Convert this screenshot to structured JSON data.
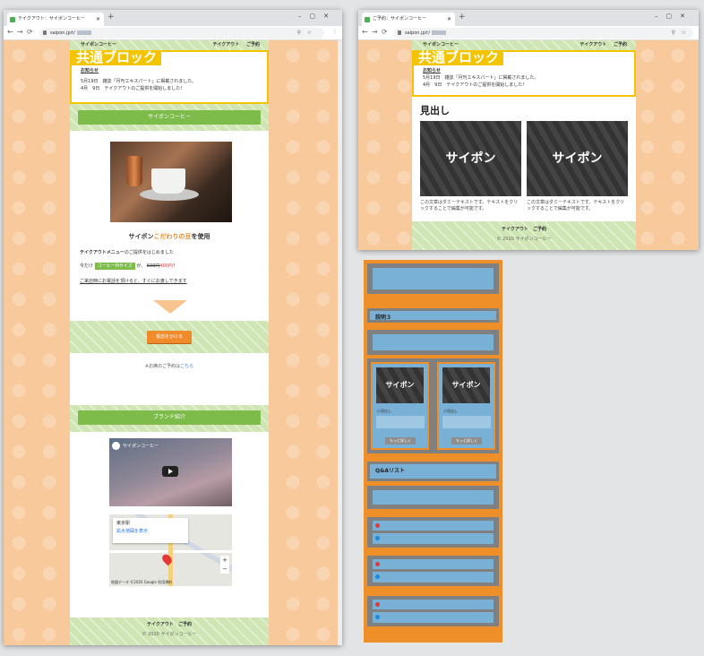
{
  "left_window": {
    "tab_title": "テイクアウト：サイポンコーヒー",
    "url": "saipon.jp/t/",
    "header": {
      "brand": "サイポンコーヒー",
      "nav": [
        "テイクアウト",
        "ご予約"
      ]
    },
    "common_block_label": "共通ブロック",
    "news": {
      "title": "お知らせ",
      "items": [
        "5月19日　雑誌「月刊エキスパート」に掲載されました。",
        "4月　9日　テイクアウトのご提供を開始しました！"
      ]
    },
    "section_bar": "サイポンコーヒー",
    "headline_prefix": "サイポン",
    "headline_emph": "こだわりの豆",
    "headline_suffix": "を使用",
    "intro_bold": "テイクアウトメニュー",
    "intro_rest": "のご提供をはじめました",
    "price_pre": "今だけ",
    "price_badge": "コーヒーMサイズ",
    "price_mid": "が、",
    "price_old": "500円",
    "price_new": "400円",
    "price_end": "！",
    "phone_note": "ご来店時にお電話を頂けると、すぐにお渡しできます",
    "call_button": "電話をかける",
    "reserve_note_pre": "※お席のご予約は",
    "reserve_link": "こちら",
    "brand_bar": "ブランド紹介",
    "video_title": "サイポンコーヒー",
    "map_station": "東京駅",
    "map_enlarge": "拡大地図を表示",
    "map_attribution": "地図データ ©2020 Google 利用規約",
    "footer_nav": [
      "テイクアウト",
      "ご予約"
    ],
    "copyright": "© 2020 サイポンコーヒー"
  },
  "right_window": {
    "tab_title": "ご予約：サイポンコーヒー",
    "url": "saipon.jp/r/",
    "header": {
      "brand": "サイポンコーヒー",
      "nav": [
        "テイクアウト",
        "ご予約"
      ]
    },
    "common_block_label": "共通ブロック",
    "news_title": "お知らせ",
    "news_items": [
      "5月19日　雑誌「月刊エキスパート」に掲載されました。",
      "4月　9日　テイクアウトのご提供を開始しました！"
    ],
    "heading": "見出し",
    "tile_text": "サイポン",
    "tile_caption": "この文章はダミーテキストです。テキストをクリックすることで編集が可能です。",
    "footer_nav": [
      "テイクアウト",
      "ご予約"
    ],
    "copyright": "© 2020 サイポンコーヒー"
  },
  "wireframe": {
    "explain_label": "説明３",
    "tile_text": "サイポン",
    "card_title": "小見出し",
    "card_button": "もっと詳しく",
    "qa_label": "Q&Aリスト"
  },
  "colors": {
    "orange_bg": "#f8c99b",
    "green": "#7dbc4b",
    "yellow": "#f5c400",
    "wire_orange": "#ef8f2a",
    "wire_blue": "#78b0d6"
  }
}
